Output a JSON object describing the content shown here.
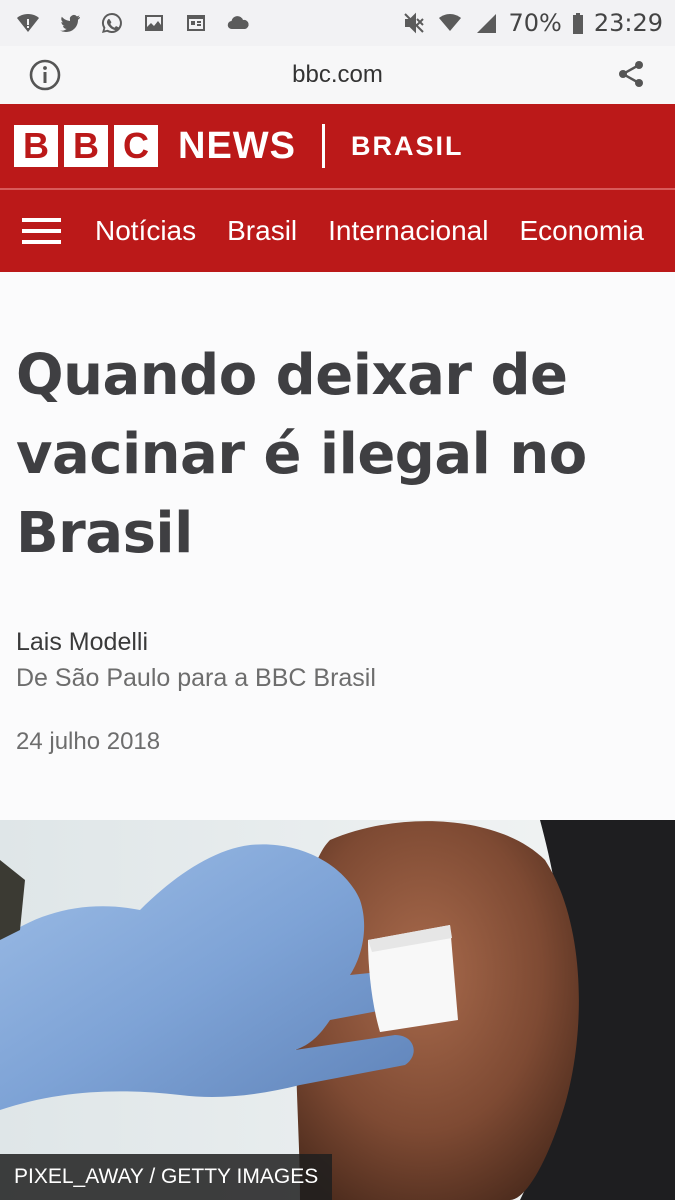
{
  "status_bar": {
    "battery": "70%",
    "time": "23:29"
  },
  "browser": {
    "url": "bbc.com"
  },
  "header": {
    "logo_letters": [
      "B",
      "B",
      "C"
    ],
    "news": "NEWS",
    "region": "BRASIL",
    "brand_color": "#bb1919"
  },
  "nav": {
    "items": [
      "Notícias",
      "Brasil",
      "Internacional",
      "Economia"
    ]
  },
  "article": {
    "headline_lines": [
      "Quando deixar de",
      "vacinar é ilegal no",
      "Brasil"
    ],
    "author": "Lais Modelli",
    "author_org": "De São Paulo para a BBC Brasil",
    "date": "24 julho 2018",
    "image_caption": "PIXEL_AWAY / GETTY IMAGES"
  }
}
